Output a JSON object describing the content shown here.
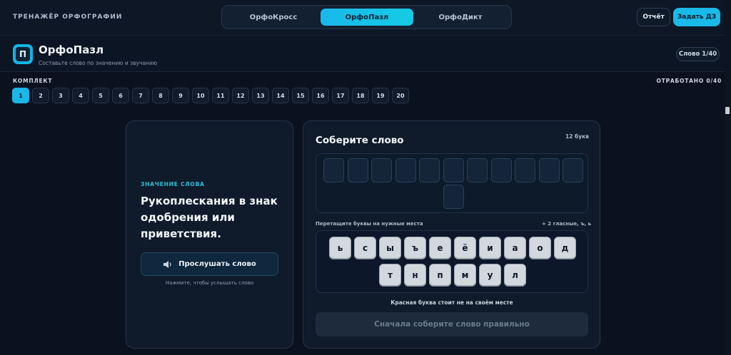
{
  "brand": "ТРЕНАЖЁР ОРФОГРАФИИ",
  "modes": [
    {
      "label": "ОрфоКросс",
      "active": false
    },
    {
      "label": "ОрфоПазл",
      "active": true
    },
    {
      "label": "ОрфоДикт",
      "active": false
    }
  ],
  "top_actions": {
    "report": "Отчёт",
    "homework": "Задать ДЗ"
  },
  "header": {
    "logo_letter": "П",
    "title": "ОрфоПазл",
    "subtitle": "Составьте слово по значению и звучанию",
    "word_counter": "Слово 1/40"
  },
  "sets": {
    "label": "КОМПЛЕКТ",
    "worked": "ОТРАБОТАНО 0/40",
    "items": [
      "1",
      "2",
      "3",
      "4",
      "5",
      "6",
      "7",
      "8",
      "9",
      "10",
      "11",
      "12",
      "13",
      "14",
      "15",
      "16",
      "17",
      "18",
      "19",
      "20"
    ],
    "active_index": 0
  },
  "meaning": {
    "label": "ЗНАЧЕНИЕ СЛОВА",
    "text": "Рукоплескания в знак одобрения или приветствия.",
    "listen_button": "Прослушать слово",
    "listen_hint": "Нажмите, чтобы услышать слово"
  },
  "puzzle": {
    "title": "Соберите слово",
    "letters_count": "12 букв",
    "slot_count": 12,
    "drag_label": "Перетащите буквы на нужные места",
    "vowel_hint": "+ 2 гласные, ъ, ь",
    "tiles_row1": [
      "ь",
      "с",
      "ы",
      "ъ",
      "е",
      "ё",
      "и",
      "а",
      "о",
      "д"
    ],
    "tiles_row2": [
      "т",
      "н",
      "п",
      "м",
      "у",
      "л"
    ],
    "red_hint": "Красная буква стоит не на своём месте",
    "submit": "Сначала соберите слово правильно"
  },
  "colors": {
    "accent": "#19b6e8",
    "background": "#0a1220",
    "card": "#0f1a2a"
  }
}
